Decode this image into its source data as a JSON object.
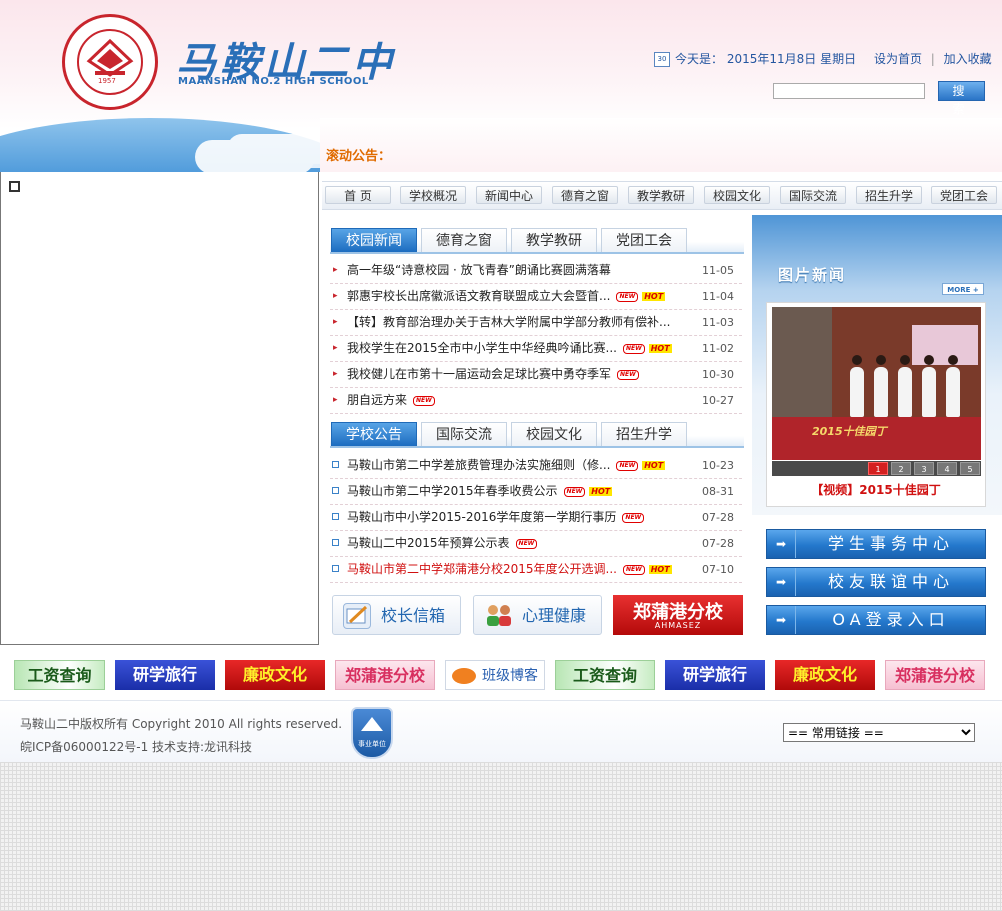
{
  "header": {
    "school_name_cn": "马鞍山二中",
    "school_name_en": "MAANSHAN NO.2 HIGH SCHOOL",
    "seal_year": "1957",
    "calendar_icon": "30",
    "date_label": "今天是：",
    "date_value": "2015年11月8日  星期日",
    "set_home": "设为首页",
    "add_favorite": "加入收藏",
    "search_placeholder": "",
    "search_button": "搜 索",
    "notice_label": "滚动公告："
  },
  "nav": [
    "首  页",
    "学校概况",
    "新闻中心",
    "德育之窗",
    "教学教研",
    "校园文化",
    "国际交流",
    "招生升学",
    "党团工会"
  ],
  "news_tabs": [
    "校园新闻",
    "德育之窗",
    "教学教研",
    "党团工会"
  ],
  "news_items": [
    {
      "title": "高一年级“诗意校园 · 放飞青春”朗诵比赛圆满落幕",
      "new": false,
      "hot": false,
      "date": "11-05"
    },
    {
      "title": "郭惠宇校长出席徽派语文教育联盟成立大会暨首...",
      "new": true,
      "hot": true,
      "date": "11-04"
    },
    {
      "title": "【转】教育部治理办关于吉林大学附属中学部分教师有偿补...",
      "new": false,
      "hot": false,
      "date": "11-03"
    },
    {
      "title": "我校学生在2015全市中小学生中华经典吟诵比赛...",
      "new": true,
      "hot": true,
      "date": "11-02"
    },
    {
      "title": "我校健儿在市第十一届运动会足球比赛中勇夺季军",
      "new": true,
      "hot": false,
      "date": "10-30"
    },
    {
      "title": "朋自远方来",
      "new": true,
      "hot": false,
      "date": "10-27"
    }
  ],
  "notice_tabs": [
    "学校公告",
    "国际交流",
    "校园文化",
    "招生升学"
  ],
  "notice_items": [
    {
      "title": "马鞍山市第二中学差旅费管理办法实施细则（修...",
      "new": true,
      "hot": true,
      "date": "10-23",
      "red": false
    },
    {
      "title": "马鞍山市第二中学2015年春季收费公示",
      "new": true,
      "hot": true,
      "date": "08-31",
      "red": false
    },
    {
      "title": "马鞍山市中小学2015-2016学年度第一学期行事历",
      "new": true,
      "hot": false,
      "date": "07-28",
      "red": false
    },
    {
      "title": "马鞍山二中2015年预算公示表",
      "new": true,
      "hot": false,
      "date": "07-28",
      "red": false
    },
    {
      "title": "马鞍山市第二中学郑蒲港分校2015年度公开选调...",
      "new": true,
      "hot": true,
      "date": "07-10",
      "red": true
    }
  ],
  "badges": {
    "new": "NEW",
    "hot": "HOT"
  },
  "quick_buttons": {
    "principal_mail": "校长信箱",
    "mental_health": "心理健康",
    "zpg_branch": "郑蒲港分校",
    "zpg_sub": "AHMASEZ"
  },
  "photo_news": {
    "title": "图片新闻",
    "more": "MORE +",
    "image_text": "2015十佳园丁",
    "caption": "【视频】2015十佳园丁",
    "pages": [
      "1",
      "2",
      "3",
      "4",
      "5"
    ],
    "active_page": "1"
  },
  "side_buttons": [
    "学生事务中心",
    "校友联谊中心",
    "OA登录入口"
  ],
  "banners": [
    "工资查询",
    "研学旅行",
    "廉政文化",
    "郑蒲港分校",
    "班级博客",
    "工资查询",
    "研学旅行",
    "廉政文化",
    "郑蒲港分校"
  ],
  "footer": {
    "copyright": "马鞍山二中版权所有  Copyright 2010 All rights reserved.",
    "icp": "皖ICP备06000122号-1  技术支持:龙讯科技",
    "gov_badge": "事业单位",
    "links_select": "== 常用链接 =="
  },
  "colors": {
    "brand_blue": "#2a6fb8",
    "brand_red": "#c8252d",
    "notice_orange": "#e06b00",
    "tab_active": "#1c6cc0"
  }
}
